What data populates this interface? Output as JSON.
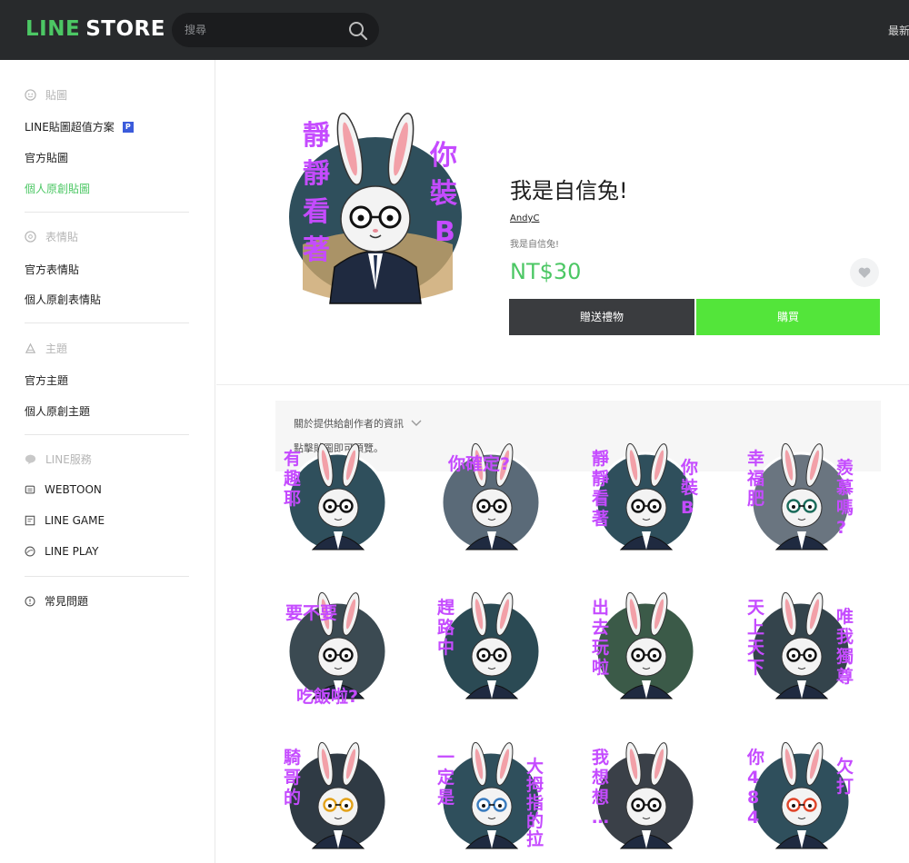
{
  "header": {
    "logo_line": "LINE",
    "logo_store": "STORE",
    "search_placeholder": "搜尋",
    "right_text": "最新"
  },
  "sidebar": {
    "sections": [
      {
        "icon": "sticker-icon",
        "title": "貼圖",
        "items": [
          {
            "label": "LINE貼圖超值方案",
            "badge": "P",
            "active": false
          },
          {
            "label": "官方貼圖",
            "active": false
          },
          {
            "label": "個人原創貼圖",
            "active": true
          }
        ]
      },
      {
        "icon": "emoji-icon",
        "title": "表情貼",
        "items": [
          {
            "label": "官方表情貼",
            "active": false
          },
          {
            "label": "個人原創表情貼",
            "active": false
          }
        ]
      },
      {
        "icon": "theme-icon",
        "title": "主題",
        "items": [
          {
            "label": "官方主題",
            "active": false
          },
          {
            "label": "個人原創主題",
            "active": false
          }
        ]
      },
      {
        "icon": "line-services-icon",
        "title": "LINE服務",
        "items": [
          {
            "label": "WEBTOON",
            "icon": "webtoon-icon"
          },
          {
            "label": "LINE GAME",
            "icon": "game-icon"
          },
          {
            "label": "LINE PLAY",
            "icon": "play-icon"
          }
        ]
      }
    ],
    "faq": {
      "label": "常見問題",
      "icon": "help-icon"
    }
  },
  "product": {
    "title": "我是自信兔!",
    "author": "AndyC",
    "description": "我是自信兔!",
    "price": "NT$30",
    "gift_label": "贈送禮物",
    "buy_label": "購買",
    "hero_text_left": "靜靜看著",
    "hero_text_right": "你裝B"
  },
  "info": {
    "creator_info": "關於提供給創作者的資訊",
    "preview_note": "點擊貼圖即可預覽。"
  },
  "stickers": [
    {
      "left": "有趣耶",
      "right": "",
      "bg": "#2f4f5c",
      "glasses": "#111111"
    },
    {
      "left": "你確定?",
      "right": "",
      "bg": "#5a6a78",
      "glasses": "#111111"
    },
    {
      "left": "靜靜看著",
      "right": "你裝B",
      "bg": "#2f4f5c",
      "glasses": "#111111"
    },
    {
      "left": "幸福肥",
      "right": "羨慕嗎?",
      "bg": "#6a7580",
      "glasses": "#1a6b5a"
    },
    {
      "left": "要不要",
      "right": "吃飯啦?",
      "bg": "#3b4a52",
      "glasses": "#111111"
    },
    {
      "left": "趕路中",
      "right": "",
      "bg": "#2b4a54",
      "glasses": "#111111"
    },
    {
      "left": "出去玩啦",
      "right": "",
      "bg": "#3b5a48",
      "glasses": "#111111"
    },
    {
      "left": "天上天下",
      "right": "唯我獨尊",
      "bg": "#34444c",
      "glasses": "#111111"
    },
    {
      "left": "騎哥的",
      "right": "",
      "bg": "#2f3a44",
      "glasses": "#e3a21a"
    },
    {
      "left": "一定是",
      "right": "大拇指的拉",
      "bg": "#2f4f5c",
      "glasses": "#3a7cbf"
    },
    {
      "left": "我想想…",
      "right": "",
      "bg": "#3a4048",
      "glasses": "#111111"
    },
    {
      "left": "你484",
      "right": "欠打",
      "bg": "#2f4f5c",
      "glasses": "#e0452a"
    }
  ]
}
